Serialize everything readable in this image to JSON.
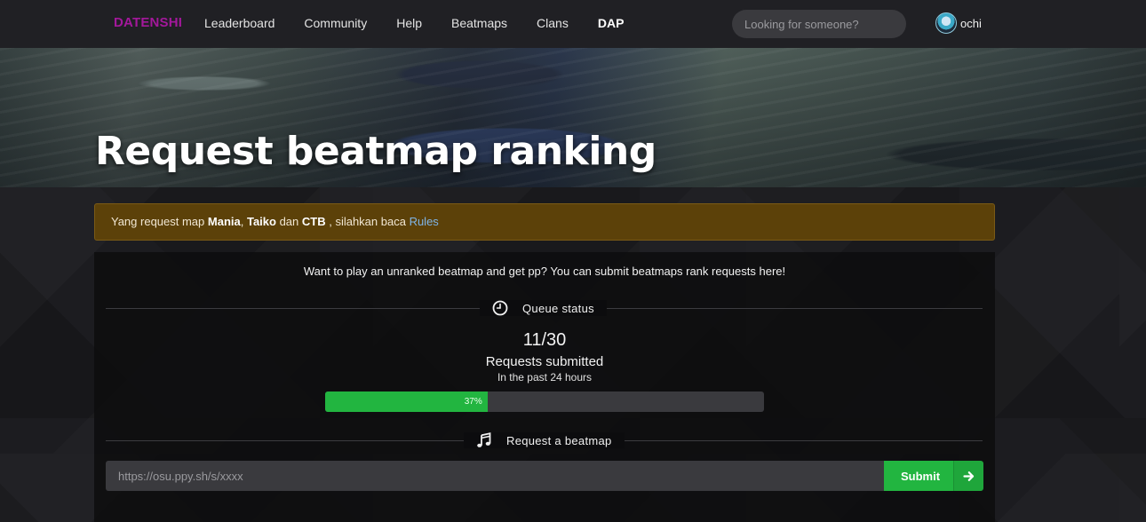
{
  "nav": {
    "logo": "DATENSHI",
    "links": [
      "Leaderboard",
      "Community",
      "Help",
      "Beatmaps",
      "Clans",
      "DAP"
    ],
    "search_placeholder": "Looking for someone?",
    "username": "ochi"
  },
  "hero": {
    "title": "Request beatmap ranking"
  },
  "alert": {
    "text_1": "Yang request map ",
    "mode_1": "Mania",
    "sep_1": ", ",
    "mode_2": "Taiko",
    "sep_2": " dan ",
    "mode_3": "CTB",
    "text_2": " , silahkan baca ",
    "link": "Rules"
  },
  "main": {
    "intro": "Want to play an unranked beatmap and get pp? You can submit beatmaps rank requests here!",
    "queue_title": "Queue status",
    "queue_count": "11/30",
    "queue_label": "Requests submitted",
    "queue_sub": "In the past 24 hours",
    "progress_percent": 37,
    "progress_label": "37%",
    "request_title": "Request a beatmap",
    "request_placeholder": "https://osu.ppy.sh/s/xxxx",
    "submit_label": "Submit"
  },
  "colors": {
    "logo": "#a3189b",
    "alert_bg": "#5c4109",
    "progress_green": "#22b540",
    "link_blue": "#7fb5e8"
  },
  "icons": {
    "search": "search-icon",
    "queue": "clock-icon",
    "request": "music-note-icon",
    "submit": "arrow-right-icon"
  }
}
